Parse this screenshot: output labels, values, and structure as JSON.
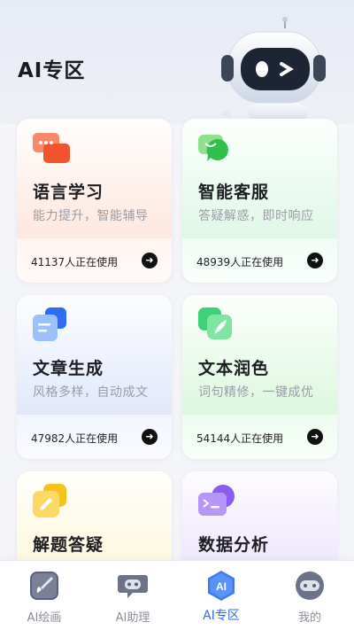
{
  "header": {
    "title": "AI专区"
  },
  "cards": [
    {
      "title": "语言学习",
      "subtitle": "能力提升，智能辅导",
      "usage": "41137人正在使用",
      "icon": "chat-bubbles-icon",
      "accent": "#f2734f"
    },
    {
      "title": "智能客服",
      "subtitle": "答疑解惑，即时响应",
      "usage": "48939人正在使用",
      "icon": "customer-service-icon",
      "accent": "#3ec95c"
    },
    {
      "title": "文章生成",
      "subtitle": "风格多样，自动成文",
      "usage": "47982人正在使用",
      "icon": "document-icon",
      "accent": "#3a7bf0"
    },
    {
      "title": "文本润色",
      "subtitle": "词句精修，一键成优",
      "usage": "54144人正在使用",
      "icon": "quill-pen-icon",
      "accent": "#33c477"
    },
    {
      "title": "解题答疑",
      "subtitle": "",
      "usage": "",
      "icon": "pencil-note-icon",
      "accent": "#f4c22c"
    },
    {
      "title": "数据分析",
      "subtitle": "",
      "usage": "",
      "icon": "terminal-icon",
      "accent": "#9a6ff0"
    }
  ],
  "tabbar": {
    "items": [
      {
        "label": "AI绘画",
        "icon": "paint-brush-icon",
        "active": false
      },
      {
        "label": "AI助理",
        "icon": "assistant-bot-icon",
        "active": false
      },
      {
        "label": "AI专区",
        "icon": "ai-hexagon-icon",
        "active": true
      },
      {
        "label": "我的",
        "icon": "profile-robot-icon",
        "active": false
      }
    ],
    "active_color": "#2f6cf0"
  }
}
